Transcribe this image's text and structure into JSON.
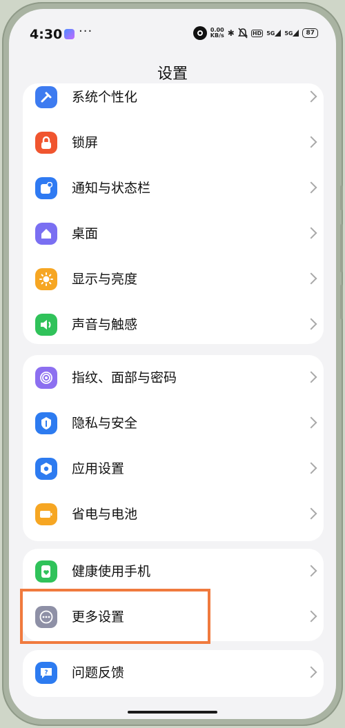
{
  "status_bar": {
    "time": "4:30",
    "more": "···",
    "net_speed_value": "0.00",
    "net_speed_unit": "KB/s",
    "hd_badge": "HD",
    "signal_1": "5G",
    "signal_2": "5G",
    "battery": "87"
  },
  "header": {
    "title": "设置"
  },
  "groups": [
    {
      "items": [
        {
          "label": "系统个性化",
          "icon": "personalization-icon",
          "color": "#3d7bf0"
        },
        {
          "label": "锁屏",
          "icon": "lock-icon",
          "color": "#f0552f"
        },
        {
          "label": "通知与状态栏",
          "icon": "notification-icon",
          "color": "#2f7af2"
        },
        {
          "label": "桌面",
          "icon": "home-icon",
          "color": "#7a6ff2"
        },
        {
          "label": "显示与亮度",
          "icon": "sun-icon",
          "color": "#f6a623"
        },
        {
          "label": "声音与触感",
          "icon": "speaker-icon",
          "color": "#30c25a"
        }
      ]
    },
    {
      "items": [
        {
          "label": "指纹、面部与密码",
          "icon": "fingerprint-icon",
          "color": "#8c6ff0"
        },
        {
          "label": "隐私与安全",
          "icon": "privacy-icon",
          "color": "#2d7bf0"
        },
        {
          "label": "应用设置",
          "icon": "app-settings-icon",
          "color": "#2d7bf0"
        },
        {
          "label": "省电与电池",
          "icon": "battery-icon",
          "color": "#f6a623"
        }
      ]
    },
    {
      "items": [
        {
          "label": "健康使用手机",
          "icon": "health-icon",
          "color": "#30c25a"
        },
        {
          "label": "更多设置",
          "icon": "more-icon",
          "color": "#8e90a6"
        }
      ]
    },
    {
      "items": [
        {
          "label": "问题反馈",
          "icon": "feedback-icon",
          "color": "#2d7bf0"
        }
      ]
    }
  ]
}
